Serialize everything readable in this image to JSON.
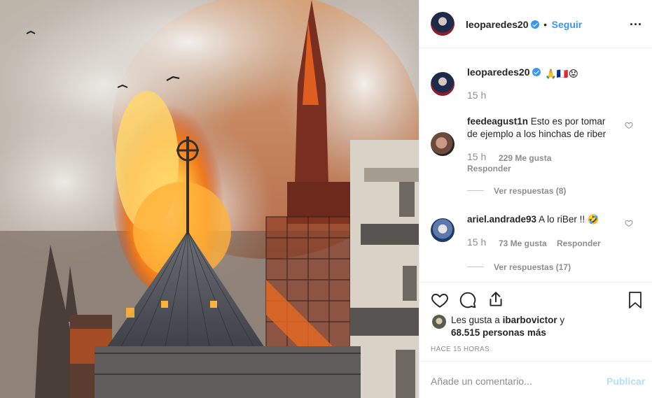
{
  "post": {
    "username": "leoparedes20",
    "follow_label": "Seguir",
    "dot": "•",
    "more_label": "...",
    "caption_emojis": "🙏🇫🇷😟",
    "caption_time": "15 h"
  },
  "comments": [
    {
      "username": "feedeagust1n",
      "text_line1": "Esto es por tomar",
      "text_line2": "de ejemplo a los hinchas de riber",
      "time": "15 h",
      "likes": "229 Me gusta",
      "reply_label": "Responder",
      "view_replies": "Ver respuestas (8)"
    },
    {
      "username": "ariel.andrade93",
      "text": "A lo riBer !! 🤣",
      "time": "15 h",
      "likes": "73 Me gusta",
      "reply_label": "Responder",
      "view_replies": "Ver respuestas (17)"
    }
  ],
  "likes": {
    "prefix": "Les gusta a",
    "liker": "ibarbovictor",
    "conj": "y",
    "others": "68.515 personas más"
  },
  "posted_ago": "HACE 15 HORAS",
  "add_comment": {
    "placeholder": "Añade un comentario...",
    "publish_label": "Publicar"
  },
  "icons": {
    "like": "heart-icon",
    "comment": "comment-icon",
    "share": "share-icon",
    "save": "bookmark-icon",
    "verified": "verified-badge-icon",
    "options": "more-options-icon"
  },
  "colors": {
    "link_blue": "#3897f0",
    "publish_disabled": "#b2dffc",
    "muted_text": "#8e8e8e",
    "text": "#262626",
    "divider": "#efefef"
  }
}
